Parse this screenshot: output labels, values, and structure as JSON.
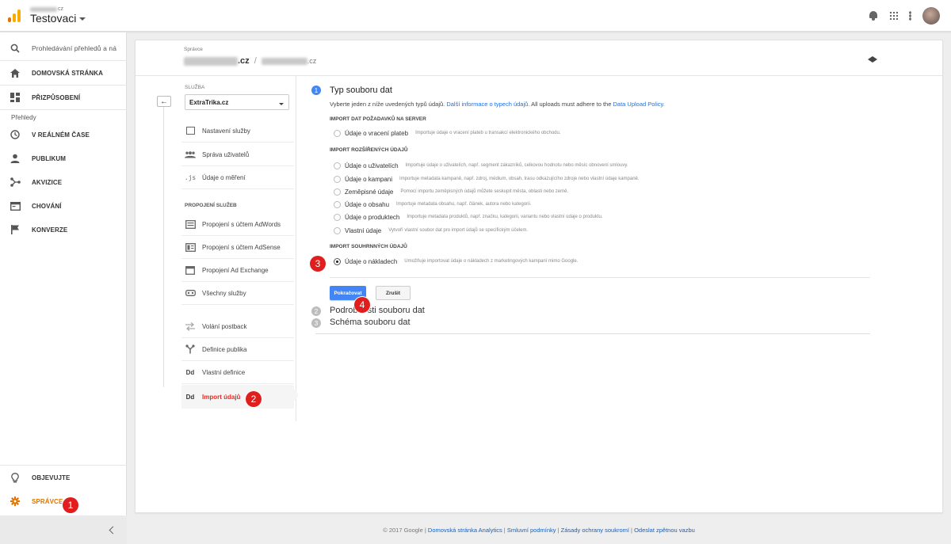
{
  "app": {
    "account_domain": "cz",
    "property_name": "Testovaci"
  },
  "leftnav": {
    "search_placeholder": "Prohledávání přehledů a ná",
    "home": "DOMOVSKÁ STRÁNKA",
    "customization": "PŘIZPŮSOBENÍ",
    "reports_section": "Přehledy",
    "realtime": "V REÁLNÉM ČASE",
    "audience": "PUBLIKUM",
    "acquisition": "AKVIZICE",
    "behavior": "CHOVÁNÍ",
    "conversions": "KONVERZE",
    "discover": "OBJEVUJTE",
    "admin": "SPRÁVCE"
  },
  "header": {
    "admin_label": "Správce",
    "breadcrumb_tld_1": ".cz",
    "breadcrumb_tld_2": ".cz"
  },
  "settings": {
    "service_label": "SLUŽBA",
    "service_value": "ExtraTrika.cz",
    "items_top": [
      "Nastavení služby",
      "Správa uživatelů",
      "Údaje o měření"
    ],
    "links_section": "PROPOJENÍ SLUŽEB",
    "items_links": [
      "Propojení s účtem AdWords",
      "Propojení s účtem AdSense",
      "Propojení Ad Exchange",
      "Všechny služby"
    ],
    "items_bottom": [
      "Volání postback",
      "Definice publika",
      "Vlastní definice",
      "Import údajů"
    ]
  },
  "wizard": {
    "step1_num": "1",
    "step1_title": "Typ souboru dat",
    "desc_text": "Vyberte jeden z níže uvedených typů údajů.",
    "desc_link": "Další informace o typech údajů.",
    "desc_policy_text": "All uploads must adhere to the",
    "desc_policy_link": "Data Upload Policy.",
    "group1_title": "IMPORT DAT POŽADAVKŮ NA SERVER",
    "group1_options": [
      {
        "label": "Údaje o vracení plateb",
        "desc": "Importuje údaje o vracení plateb u transakcí elektronického obchodu."
      }
    ],
    "group2_title": "IMPORT ROZŠÍŘENÝCH ÚDAJŮ",
    "group2_options": [
      {
        "label": "Údaje o uživatelích",
        "desc": "Importuje údaje o uživatelích, např. segment zákazníků, celkovou hodnotu nebo měsíc obnovení smlouvy."
      },
      {
        "label": "Údaje o kampani",
        "desc": "Importuje metadata kampaně, např. zdroj, médium, obsah, trasu odkazujícího zdroje nebo vlastní údaje kampaně."
      },
      {
        "label": "Zeměpisné údaje",
        "desc": "Pomocí importu zeměpisných údajů můžete seskupit města, oblasti nebo země."
      },
      {
        "label": "Údaje o obsahu",
        "desc": "Importuje metadata obsahu, např. článek, autora nebo kategorii."
      },
      {
        "label": "Údaje o produktech",
        "desc": "Importuje metadata produktů, např. značku, kategorii, variantu nebo vlastní údaje o produktu."
      },
      {
        "label": "Vlastní údaje",
        "desc": "Vytvoří vlastní soubor dat pro import údajů se specifickým účelem."
      }
    ],
    "group3_title": "IMPORT SOUHRNNÝCH ÚDAJŮ",
    "group3_options": [
      {
        "label": "Údaje o nákladech",
        "desc": "Umožňuje importovat údaje o nákladech z marketingových kampaní mimo Google."
      }
    ],
    "continue_button": "Pokračovat",
    "cancel_button": "Zrušit",
    "step2_num": "2",
    "step2_title": "Podrobnosti souboru dat",
    "step3_num": "3",
    "step3_title": "Schéma souboru dat"
  },
  "markers": [
    "1",
    "2",
    "3",
    "4"
  ],
  "footer": {
    "copyright": "© 2017 Google",
    "links": [
      "Domovská stránka Analytics",
      "Smluvní podmínky",
      "Zásady ochrany soukromí",
      "Odeslat zpětnou vazbu"
    ]
  },
  "colors": {
    "accent_blue": "#4285f4",
    "admin_orange": "#e37400",
    "marker_red": "#e01e1e",
    "active_link_red": "#e52d27"
  }
}
